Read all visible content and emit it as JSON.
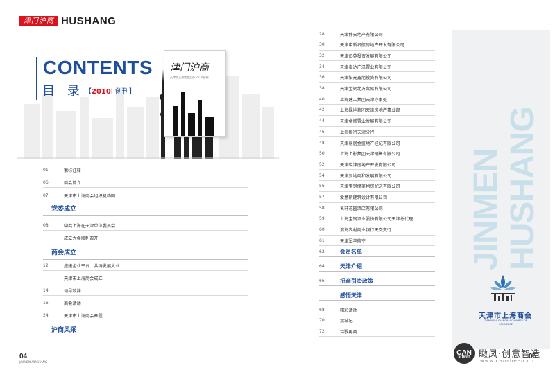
{
  "brand": {
    "logo_text": "津门沪商",
    "name": "HUSHANG"
  },
  "header": {
    "contents": "CONTENTS",
    "mulu": "目 录",
    "edition_open": "【",
    "edition_year": "2010",
    "edition_text": "l 创刊】"
  },
  "cover": {
    "title": "津门沪商",
    "subtitle": "天津市上海商会主办 2010创刊"
  },
  "left_toc": {
    "intro": [
      {
        "page": "01",
        "text": "徽标注释"
      },
      {
        "page": "06",
        "text": "商会简介"
      },
      {
        "page": "07",
        "text": "天津市上海商会组织机构图"
      }
    ],
    "sec1": "党委成立",
    "sec1_items": [
      {
        "page": "08",
        "text": "中共上海在天津单位委员会"
      },
      {
        "page": "",
        "text": "成立大会顺利召开"
      }
    ],
    "sec2": "商会成立",
    "sec2_items": [
      {
        "page": "12",
        "text": "搭建企业平台　共铸发展大业"
      },
      {
        "page": "",
        "text": "天津市上海商会成立"
      },
      {
        "page": "14",
        "text": "领导致辞"
      },
      {
        "page": "16",
        "text": "商会活动"
      },
      {
        "page": "24",
        "text": "天津市上海商会章程"
      }
    ],
    "sec3": "沪商风采"
  },
  "right_toc": {
    "items": [
      {
        "page": "28",
        "text": "天津静安地产有限公司"
      },
      {
        "page": "30",
        "text": "天津中新名航房地产开发有限公司"
      },
      {
        "page": "32",
        "text": "天津亿苑投资发展有限公司"
      },
      {
        "page": "34",
        "text": "天津泰达广泽置业有限公司"
      },
      {
        "page": "36",
        "text": "天津阳光鑫旭投资有限公司"
      },
      {
        "page": "38",
        "text": "天津宝钢北方贸易有限公司"
      },
      {
        "page": "40",
        "text": "上海建工集团天津办事处"
      },
      {
        "page": "42",
        "text": "上海绿地集团天津房地产事业部"
      },
      {
        "page": "44",
        "text": "天津金盛置业发展有限公司"
      },
      {
        "page": "46",
        "text": "上海银行天津分行"
      },
      {
        "page": "48",
        "text": "天津易居金盛地产经纪有限公司"
      },
      {
        "page": "50",
        "text": "上海上影集团天津销售有限公司"
      },
      {
        "page": "52",
        "text": "天津晓津房地产开发有限公司"
      },
      {
        "page": "54",
        "text": "天津复地商和发展有限公司"
      },
      {
        "page": "56",
        "text": "天津宝钢储菱物资配送有限公司"
      },
      {
        "page": "57",
        "text": "爱意斯建筑设计有限公司"
      },
      {
        "page": "58",
        "text": "名轩花园酒店有限公司"
      },
      {
        "page": "59",
        "text": "上海宝钢酒业股份有限公司天津总代理"
      },
      {
        "page": "60",
        "text": "滨海农村商业银行天交支行"
      },
      {
        "page": "61",
        "text": "天津军华航空"
      }
    ],
    "sections": [
      {
        "page": "62",
        "text": "会员名单"
      },
      {
        "page": "64",
        "text": "天津介绍"
      },
      {
        "page": "66",
        "text": "招商引资政策"
      },
      {
        "page": "",
        "text": "感悟天津"
      }
    ],
    "tail": [
      {
        "page": "68",
        "text": "精彩活动"
      },
      {
        "page": "70",
        "text": "双城记"
      },
      {
        "page": "72",
        "text": "诗歌再商"
      }
    ]
  },
  "banner": {
    "word1": "JINMEN",
    "word2": "HUSHANG"
  },
  "chamber": {
    "cn": "天津市上海商会",
    "en": "TIANJINSHI SHANGHAI CHAMBER OF COMMERCE"
  },
  "pages": {
    "left": "04",
    "left_sub": "JINMEN HUSHANG",
    "right": "05"
  },
  "watermark": {
    "logo": "CAN",
    "logo_sub": "sheen",
    "text": "瞰凤·创意智造",
    "url": "www.cansheen.cn"
  },
  "colors": {
    "accent": "#1f4e9b",
    "brand_red": "#d8141c",
    "banner_text": "#c9e0ea"
  }
}
